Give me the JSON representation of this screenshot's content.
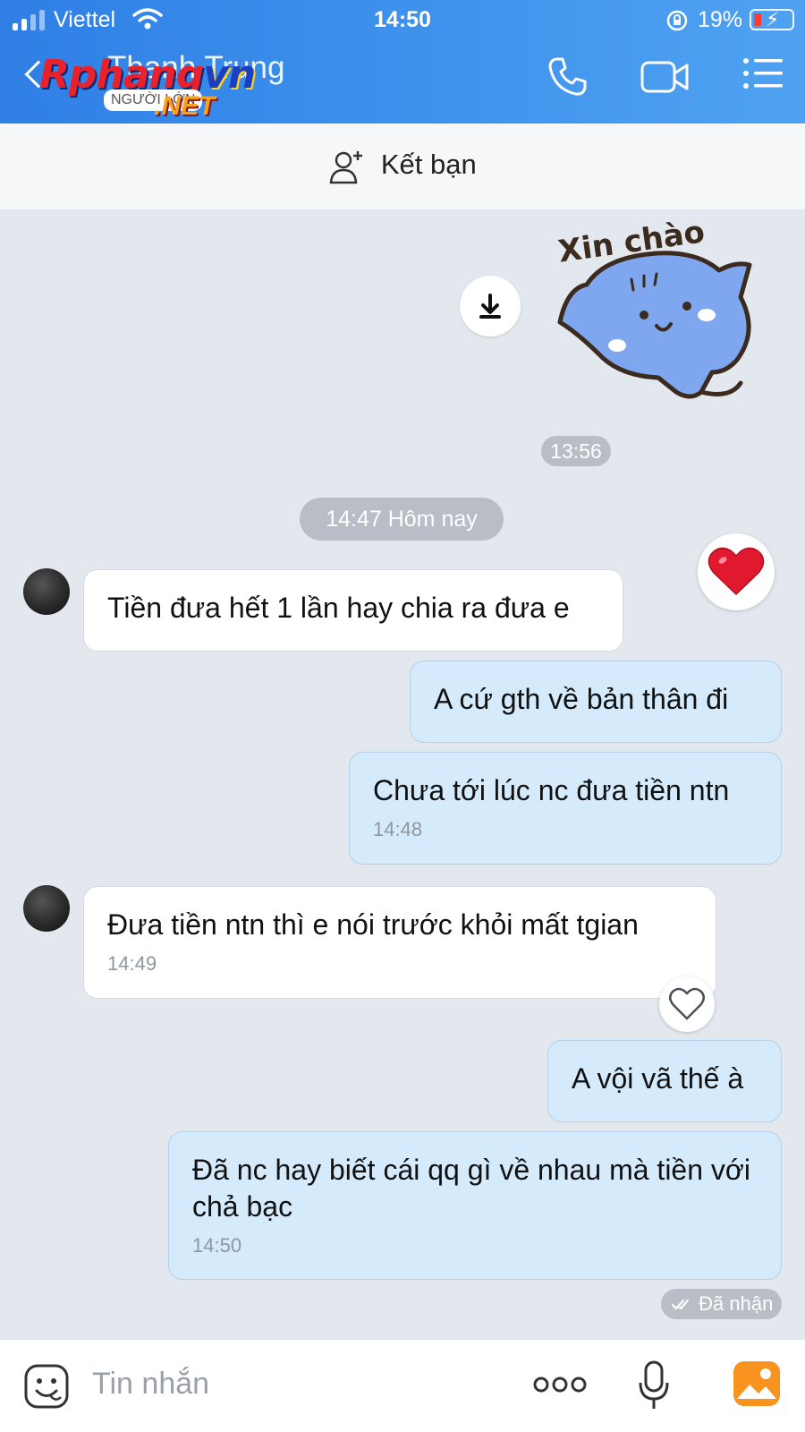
{
  "status": {
    "carrier": "Viettel",
    "time": "14:50",
    "battery": "19%"
  },
  "header": {
    "contact_name": "Thanh Trung"
  },
  "watermark": {
    "brand_a": "Rphang",
    "brand_b": "vn",
    "tag": "NGƯỜI LỚN",
    "suffix": ".NET"
  },
  "friend_bar": {
    "label": "Kết bạn"
  },
  "sticker": {
    "caption": "Xin chào",
    "time": "13:56"
  },
  "date_separator": "14:47 Hôm nay",
  "messages": [
    {
      "from": "them",
      "text": "Tiền đưa hết 1 lần hay chia ra đưa e",
      "reaction": "heart-red"
    },
    {
      "from": "me",
      "text": "A cứ gth về bản thân đi"
    },
    {
      "from": "me",
      "text": "Chưa tới lúc nc đưa tiền ntn",
      "time": "14:48"
    },
    {
      "from": "them",
      "text": "Đưa tiền ntn thì e nói trước khỏi mất tgian",
      "time": "14:49",
      "reaction": "heart-outline"
    },
    {
      "from": "me",
      "text": "A vội vã thế à"
    },
    {
      "from": "me",
      "text": "Đã nc hay biết cái qq gì về nhau mà tiền với chả bạc",
      "time": "14:50"
    }
  ],
  "receipt": "Đã nhận",
  "input": {
    "placeholder": "Tin nhắn"
  },
  "colors": {
    "header": "#3a8ae9",
    "bubble_out": "#d5ebfc",
    "bubble_in": "#ffffff",
    "chat_bg": "#e3e8ef"
  }
}
